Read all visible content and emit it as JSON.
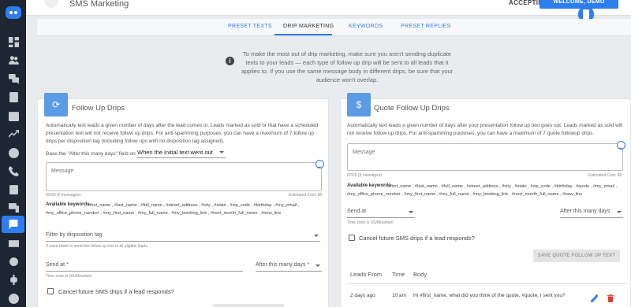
{
  "header": {
    "title": "SMS Marketing",
    "status": "ACCEPTING",
    "welcome": "WELCOME, DEMO"
  },
  "tabs": [
    {
      "label": "PRESET TEXTS"
    },
    {
      "label": "DRIP MARKETING"
    },
    {
      "label": "KEYWORDS"
    },
    {
      "label": "PRESET REPLIES"
    }
  ],
  "info": "To make the most out of drip marketing, make sure you aren't sending duplicate texts to your leads — each type of follow up drip will be sent to all leads that it applies to. If you use the same message body in different drips, be sure that your audience won't overlap.",
  "left": {
    "icon": "refresh-icon",
    "title": "Follow Up Drips",
    "description": "Automatically text leads a given number of days after the lead comes in. Leads marked as sold or that have a scheduled presentation text will not receive follow up drips. For anti-spamming purposes, you can have a maximum of 7 follow up drips per disposition tag (including follow ups with no disposition tag assigned).",
    "base_label": "Base the \"After this many days\" field on",
    "base_value": "When the initial text went out",
    "message_placeholder": "Message",
    "counter": "0/320 (0 messages)",
    "cost": "Estimated Cost: $0",
    "keywords_title": "Available keywords",
    "keywords_line1": "#first_name , #last_name , #full_name , #street_address , #city , #state , #zip_code , #birthday , #my_email ,",
    "keywords_line2": "#my_office_phone_number , #my_first_name , #my_full_name , #my_booking_link , #next_month_full_name , #new_line",
    "filter_label": "Filter by disposition tag",
    "filter_hint": "*Leave blank to send this follow up text to all eligible leads.",
    "send_at": "Send at *",
    "after_days": "After this many days *",
    "timezone": "Time zone is US/Mountain",
    "cancel_label": "Cancel future SMS drips if a lead responds?"
  },
  "right": {
    "icon": "dollar-icon",
    "title": "Quote Follow Up Drips",
    "description": "Automatically text leads a given number of days after your presentation follow up text goes out. Leads marked as sold will not receive follow up drips. For anti-spamming purposes, you can have a maximum of 7 quote followup drips.",
    "message_placeholder": "Message",
    "counter": "0/320 (0 messages)",
    "cost": "Estimated Cost: $0",
    "keywords_title": "Available keywords",
    "keywords_line1": "#first_name , #last_name , #full_name , #street_address , #city , #state , #zip_code , #birthday , #quote , #my_email ,",
    "keywords_line2": "#my_office_phone_number , #my_first_name , #my_full_name , #my_booking_link , #next_month_full_name , #new_line",
    "send_at": "Send at",
    "after_days": "After this many days",
    "timezone": "Time zone is US/Mountain",
    "cancel_label": "Cancel future SMS drips if a lead responds?",
    "save_button": "SAVE QUOTE FOLLOW UP TEXT",
    "table": {
      "headers": [
        "Leads From",
        "Time",
        "Body"
      ],
      "rows": [
        {
          "leads_from": "2 days ago",
          "time": "10 am",
          "body": "Hi #first_name, what did you think of the quote, #quote, I sent you?"
        }
      ]
    }
  }
}
